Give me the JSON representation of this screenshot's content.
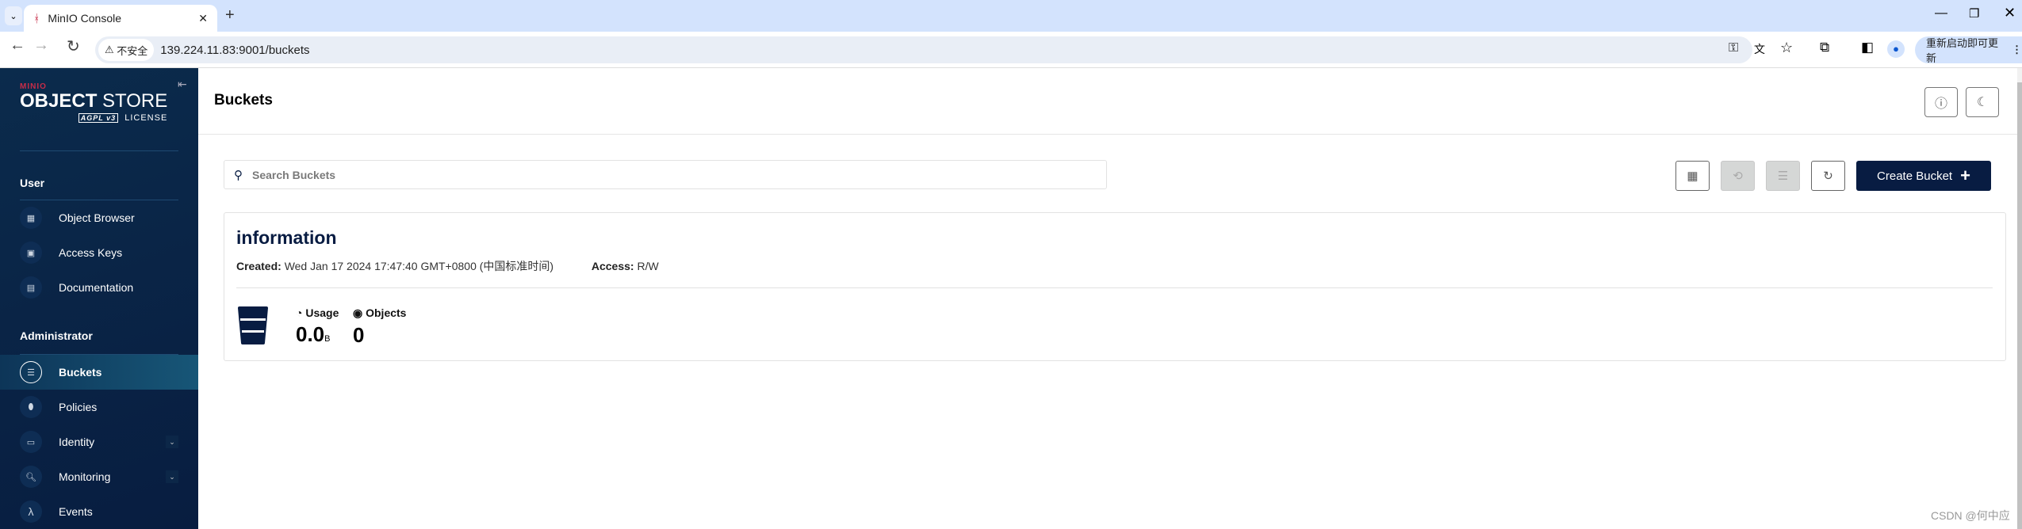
{
  "browser": {
    "tab_title": "MinIO Console",
    "url": "139.224.11.83:9001/buckets",
    "security_label": "不安全",
    "update_label": "重新启动即可更新"
  },
  "sidebar": {
    "logo": {
      "brand": "MINIO",
      "product": "OBJECT STORE",
      "license": "LICENSE",
      "badge": "AGPL v3"
    },
    "sections": [
      {
        "label": "User",
        "items": [
          {
            "label": "Object Browser",
            "icon": "object-browser-icon"
          },
          {
            "label": "Access Keys",
            "icon": "access-keys-icon"
          },
          {
            "label": "Documentation",
            "icon": "documentation-icon"
          }
        ]
      },
      {
        "label": "Administrator",
        "items": [
          {
            "label": "Buckets",
            "icon": "bucket-icon",
            "active": true
          },
          {
            "label": "Policies",
            "icon": "policy-icon"
          },
          {
            "label": "Identity",
            "icon": "identity-icon",
            "expandable": true
          },
          {
            "label": "Monitoring",
            "icon": "monitoring-icon",
            "expandable": true
          },
          {
            "label": "Events",
            "icon": "lambda-icon"
          }
        ]
      }
    ]
  },
  "header": {
    "title": "Buckets"
  },
  "toolbar": {
    "search_placeholder": "Search Buckets",
    "create_label": "Create Bucket"
  },
  "buckets": [
    {
      "name": "information",
      "created_label": "Created:",
      "created": "Wed Jan 17 2024 17:47:40 GMT+0800 (中国标准时间)",
      "access_label": "Access:",
      "access": "R/W",
      "usage_label": "Usage",
      "usage_value": "0.0",
      "usage_unit": "B",
      "objects_label": "Objects",
      "objects_value": "0"
    }
  ],
  "watermark": "CSDN @何中应",
  "colors": {
    "sidebar": "#0b2b4c",
    "accent": "#081c42",
    "active": "#175677"
  }
}
